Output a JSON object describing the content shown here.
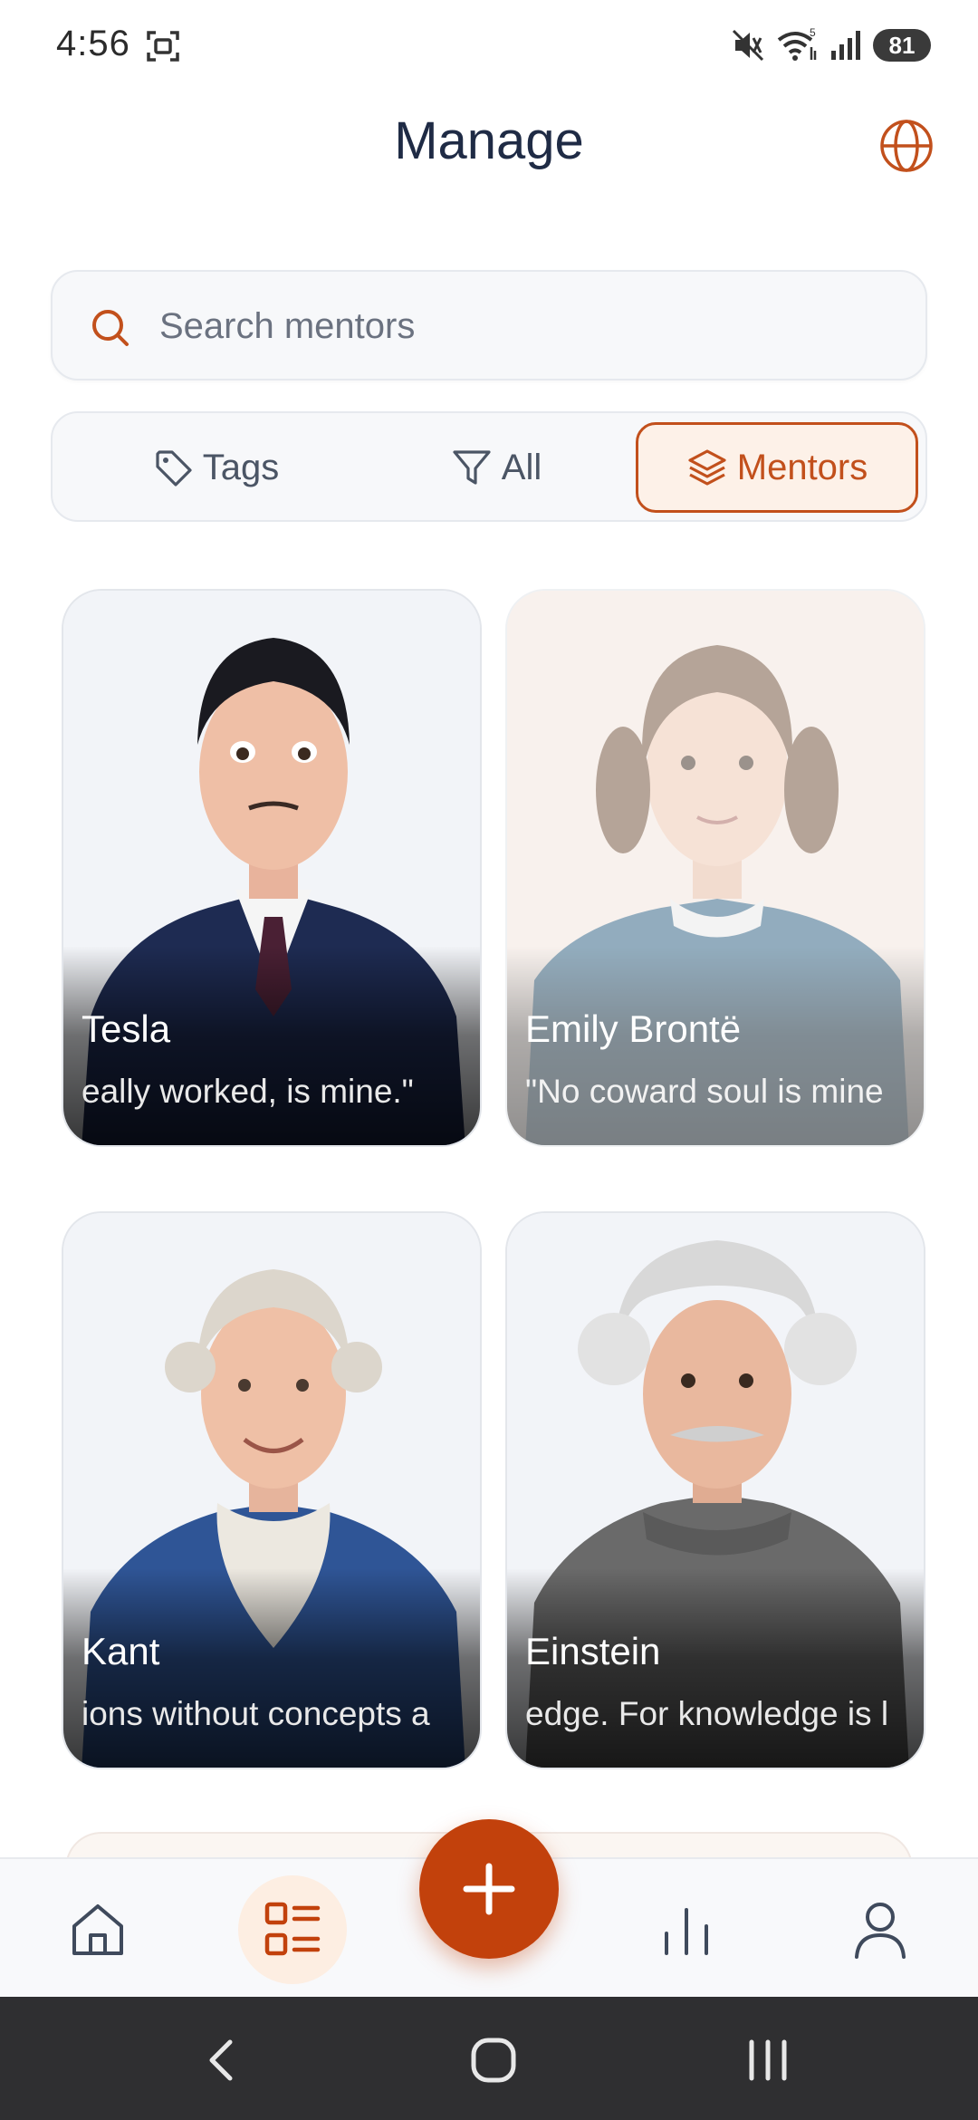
{
  "status_bar": {
    "time": "4:56",
    "battery": "81",
    "icons": [
      "screenshot-icon",
      "mute-icon",
      "wifi-icon",
      "signal-icon",
      "battery-icon"
    ]
  },
  "header": {
    "title": "Manage",
    "globe_icon": "globe-icon"
  },
  "search": {
    "placeholder": "Search mentors",
    "value": ""
  },
  "filters": {
    "tabs": [
      {
        "label": "Tags",
        "icon": "tag-icon",
        "selected": false
      },
      {
        "label": "All",
        "icon": "filter-icon",
        "selected": false
      },
      {
        "label": "Mentors",
        "icon": "layers-icon",
        "selected": true
      }
    ]
  },
  "mentors": [
    {
      "name": "Tesla",
      "quote": "eally worked, is mine.\"",
      "active": true
    },
    {
      "name": "Emily Brontë",
      "quote": "\"No coward soul is mine",
      "active": false
    },
    {
      "name": "Kant",
      "quote": "ions without concepts a",
      "active": true
    },
    {
      "name": "Einstein",
      "quote": "edge. For knowledge is l",
      "active": true
    }
  ],
  "bottom_nav": {
    "items": [
      "home-icon",
      "manage-icon",
      "add-icon",
      "stats-icon",
      "profile-icon"
    ],
    "selected": "manage-icon"
  },
  "colors": {
    "accent": "#c2410c",
    "title": "#1f2b45",
    "muted": "#6b7280"
  }
}
